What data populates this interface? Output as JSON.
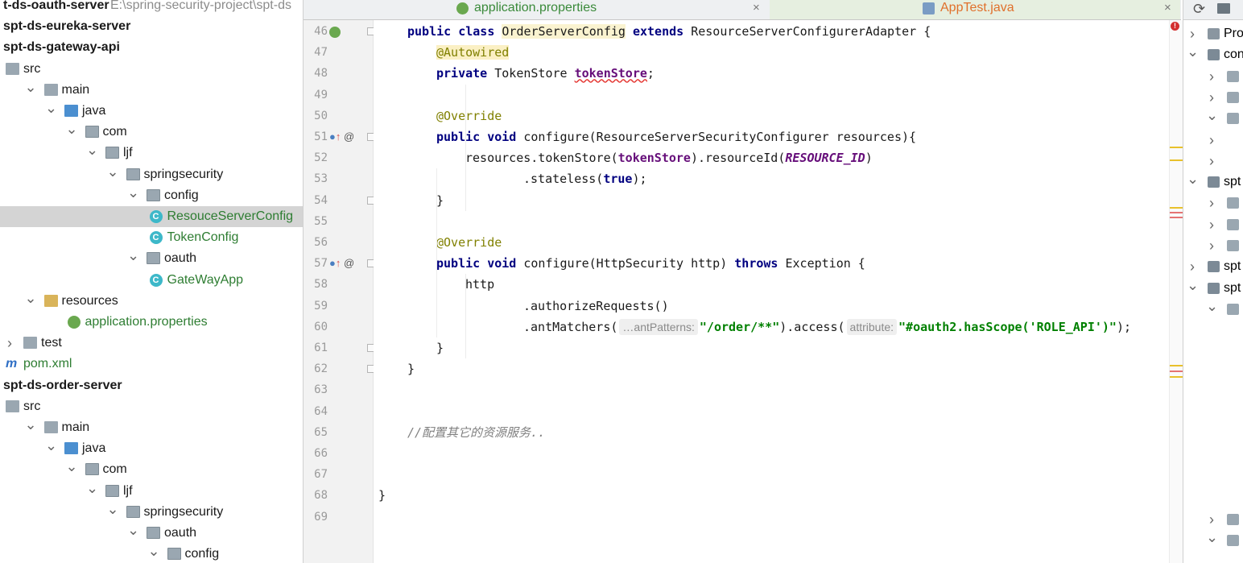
{
  "project_tree": [
    {
      "label": "t-ds-oauth-server",
      "suffix": "E:\\spring-security-project\\spt-ds",
      "indent": 0,
      "arrow": "",
      "icon": "",
      "style": "bold"
    },
    {
      "label": "spt-ds-eureka-server",
      "indent": 0,
      "arrow": "",
      "icon": "",
      "style": "bold"
    },
    {
      "label": "spt-ds-gateway-api",
      "indent": 0,
      "arrow": "",
      "icon": "",
      "style": "bold"
    },
    {
      "label": "src",
      "indent": 0,
      "arrow": "",
      "icon": "folder"
    },
    {
      "label": "main",
      "indent": 1,
      "arrow": "▼",
      "icon": "folder"
    },
    {
      "label": "java",
      "indent": 2,
      "arrow": "▼",
      "icon": "folder-src"
    },
    {
      "label": "com",
      "indent": 3,
      "arrow": "▼",
      "icon": "folder-pkg"
    },
    {
      "label": "ljf",
      "indent": 4,
      "arrow": "▼",
      "icon": "folder-pkg"
    },
    {
      "label": "springsecurity",
      "indent": 5,
      "arrow": "▼",
      "icon": "folder-pkg"
    },
    {
      "label": "config",
      "indent": 6,
      "arrow": "▼",
      "icon": "folder-pkg"
    },
    {
      "label": "ResouceServerConfig",
      "indent": 7,
      "arrow": "",
      "icon": "class",
      "style": "green",
      "selected": true
    },
    {
      "label": "TokenConfig",
      "indent": 7,
      "arrow": "",
      "icon": "class",
      "style": "green"
    },
    {
      "label": "oauth",
      "indent": 6,
      "arrow": "▼",
      "icon": "folder-pkg"
    },
    {
      "label": "GateWayApp",
      "indent": 7,
      "arrow": "",
      "icon": "spring-class",
      "style": "green"
    },
    {
      "label": "resources",
      "indent": 1,
      "arrow": "▼",
      "icon": "folder-res"
    },
    {
      "label": "application.properties",
      "indent": 3,
      "arrow": "",
      "icon": "spring",
      "style": "green"
    },
    {
      "label": "test",
      "indent": 0,
      "arrow": "›",
      "icon": "folder"
    },
    {
      "label": "pom.xml",
      "indent": 0,
      "arrow": "",
      "icon": "maven",
      "style": "green"
    },
    {
      "label": "spt-ds-order-server",
      "indent": 0,
      "arrow": "",
      "icon": "",
      "style": "bold"
    },
    {
      "label": "src",
      "indent": 0,
      "arrow": "",
      "icon": "folder"
    },
    {
      "label": "main",
      "indent": 1,
      "arrow": "▼",
      "icon": "folder"
    },
    {
      "label": "java",
      "indent": 2,
      "arrow": "▼",
      "icon": "folder-src"
    },
    {
      "label": "com",
      "indent": 3,
      "arrow": "▼",
      "icon": "folder-pkg"
    },
    {
      "label": "ljf",
      "indent": 4,
      "arrow": "▼",
      "icon": "folder-pkg"
    },
    {
      "label": "springsecurity",
      "indent": 5,
      "arrow": "▼",
      "icon": "folder-pkg"
    },
    {
      "label": "oauth",
      "indent": 6,
      "arrow": "▼",
      "icon": "folder-pkg"
    },
    {
      "label": "config",
      "indent": 7,
      "arrow": "▼",
      "icon": "folder-pkg"
    }
  ],
  "tabs": [
    {
      "label": "application.properties",
      "active": false,
      "close": "×"
    },
    {
      "label": "AppTest.java",
      "active": true,
      "close": "×"
    }
  ],
  "editor": {
    "lines": [
      {
        "num": "46",
        "gutter": "spring",
        "fold": true,
        "indent": 1,
        "tokens": [
          [
            "kw",
            "public class "
          ],
          [
            "hl",
            "OrderServerConfig"
          ],
          [
            "kw",
            " extends "
          ],
          [
            "",
            "ResourceServerConfigurerAdapter {"
          ]
        ]
      },
      {
        "num": "47",
        "indent": 2,
        "tokens": [
          [
            "ann hl2",
            "@Autowired"
          ]
        ]
      },
      {
        "num": "48",
        "indent": 2,
        "tokens": [
          [
            "kw",
            "private "
          ],
          [
            "",
            "TokenStore "
          ],
          [
            "field squiggle",
            "tokenStore"
          ],
          [
            "",
            ";"
          ]
        ]
      },
      {
        "num": "49",
        "indent": 0,
        "tokens": []
      },
      {
        "num": "50",
        "indent": 2,
        "tokens": [
          [
            "ann",
            "@Override"
          ]
        ]
      },
      {
        "num": "51",
        "gutter": "override",
        "fold": true,
        "indent": 2,
        "tokens": [
          [
            "kw",
            "public void "
          ],
          [
            "",
            "configure(ResourceServerSecurityConfigurer resources){"
          ]
        ]
      },
      {
        "num": "52",
        "indent": 3,
        "tokens": [
          [
            "",
            "resources.tokenStore("
          ],
          [
            "field",
            "tokenStore"
          ],
          [
            "",
            ").resourceId("
          ],
          [
            "constant",
            "RESOURCE_ID"
          ],
          [
            "",
            ")"
          ]
        ]
      },
      {
        "num": "53",
        "indent": 5,
        "tokens": [
          [
            "",
            ".stateless("
          ],
          [
            "kw",
            "true"
          ],
          [
            "",
            ");"
          ]
        ]
      },
      {
        "num": "54",
        "fold": true,
        "indent": 2,
        "tokens": [
          [
            "",
            "}"
          ]
        ]
      },
      {
        "num": "55",
        "indent": 0,
        "tokens": []
      },
      {
        "num": "56",
        "indent": 2,
        "tokens": [
          [
            "ann",
            "@Override"
          ]
        ]
      },
      {
        "num": "57",
        "gutter": "override",
        "fold": true,
        "indent": 2,
        "tokens": [
          [
            "kw",
            "public void "
          ],
          [
            "",
            "configure(HttpSecurity http) "
          ],
          [
            "kw",
            "throws "
          ],
          [
            "",
            "Exception {"
          ]
        ]
      },
      {
        "num": "58",
        "indent": 3,
        "tokens": [
          [
            "",
            "http"
          ]
        ]
      },
      {
        "num": "59",
        "indent": 5,
        "tokens": [
          [
            "",
            ".authorizeRequests()"
          ]
        ]
      },
      {
        "num": "60",
        "indent": 5,
        "tokens": [
          [
            "",
            ".antMatchers("
          ],
          [
            "hint",
            "…antPatterns:"
          ],
          [
            "str",
            "\"/order/**\""
          ],
          [
            "",
            ").access("
          ],
          [
            "hint",
            "attribute:"
          ],
          [
            "str",
            "\"#oauth2.hasScope('ROLE_API')\""
          ],
          [
            "",
            ");"
          ]
        ]
      },
      {
        "num": "61",
        "fold": true,
        "indent": 2,
        "tokens": [
          [
            "",
            "}"
          ]
        ]
      },
      {
        "num": "62",
        "fold": true,
        "indent": 1,
        "tokens": [
          [
            "",
            "}"
          ]
        ]
      },
      {
        "num": "63",
        "indent": 0,
        "tokens": []
      },
      {
        "num": "64",
        "indent": 0,
        "tokens": []
      },
      {
        "num": "65",
        "indent": 1,
        "tokens": [
          [
            "comment",
            "//配置其它的资源服务.."
          ]
        ]
      },
      {
        "num": "66",
        "indent": 0,
        "tokens": []
      },
      {
        "num": "67",
        "indent": 0,
        "tokens": []
      },
      {
        "num": "68",
        "indent": 0,
        "tokens": [
          [
            "",
            "}"
          ]
        ]
      },
      {
        "num": "69",
        "indent": 0,
        "tokens": []
      }
    ]
  },
  "right_panel": [
    {
      "label": "Pro",
      "arrow": "›",
      "icon": "project"
    },
    {
      "label": "con",
      "arrow": "▼",
      "icon": "module"
    },
    {
      "label": "",
      "arrow": "›",
      "icon": "gear"
    },
    {
      "label": "",
      "arrow": "›",
      "icon": "gear"
    },
    {
      "label": "",
      "arrow": "▼",
      "icon": "lib"
    },
    {
      "label": "",
      "arrow": "›",
      "icon": ""
    },
    {
      "label": "",
      "arrow": "›",
      "icon": ""
    },
    {
      "label": "spt",
      "arrow": "▼",
      "icon": "module"
    },
    {
      "label": "",
      "arrow": "›",
      "icon": "gear"
    },
    {
      "label": "",
      "arrow": "›",
      "icon": "gear"
    },
    {
      "label": "",
      "arrow": "›",
      "icon": "lib"
    },
    {
      "label": "spt",
      "arrow": "›",
      "icon": "module"
    },
    {
      "label": "spt",
      "arrow": "▼",
      "icon": "module"
    },
    {
      "label": "",
      "arrow": "▼",
      "icon": "gear"
    }
  ],
  "right_panel_bottom": [
    {
      "label": "",
      "arrow": "›",
      "icon": "gear"
    },
    {
      "label": "",
      "arrow": "▼",
      "icon": "lib"
    }
  ],
  "icons": {
    "refresh": "refresh-icon",
    "folder_settings": "folder-settings-icon",
    "error": "error-icon"
  },
  "colors": {
    "keyword": "#000080",
    "annotation": "#808000",
    "field": "#660e7a",
    "string": "#008000",
    "comment": "#808080",
    "selection": "#d4d4d4"
  }
}
